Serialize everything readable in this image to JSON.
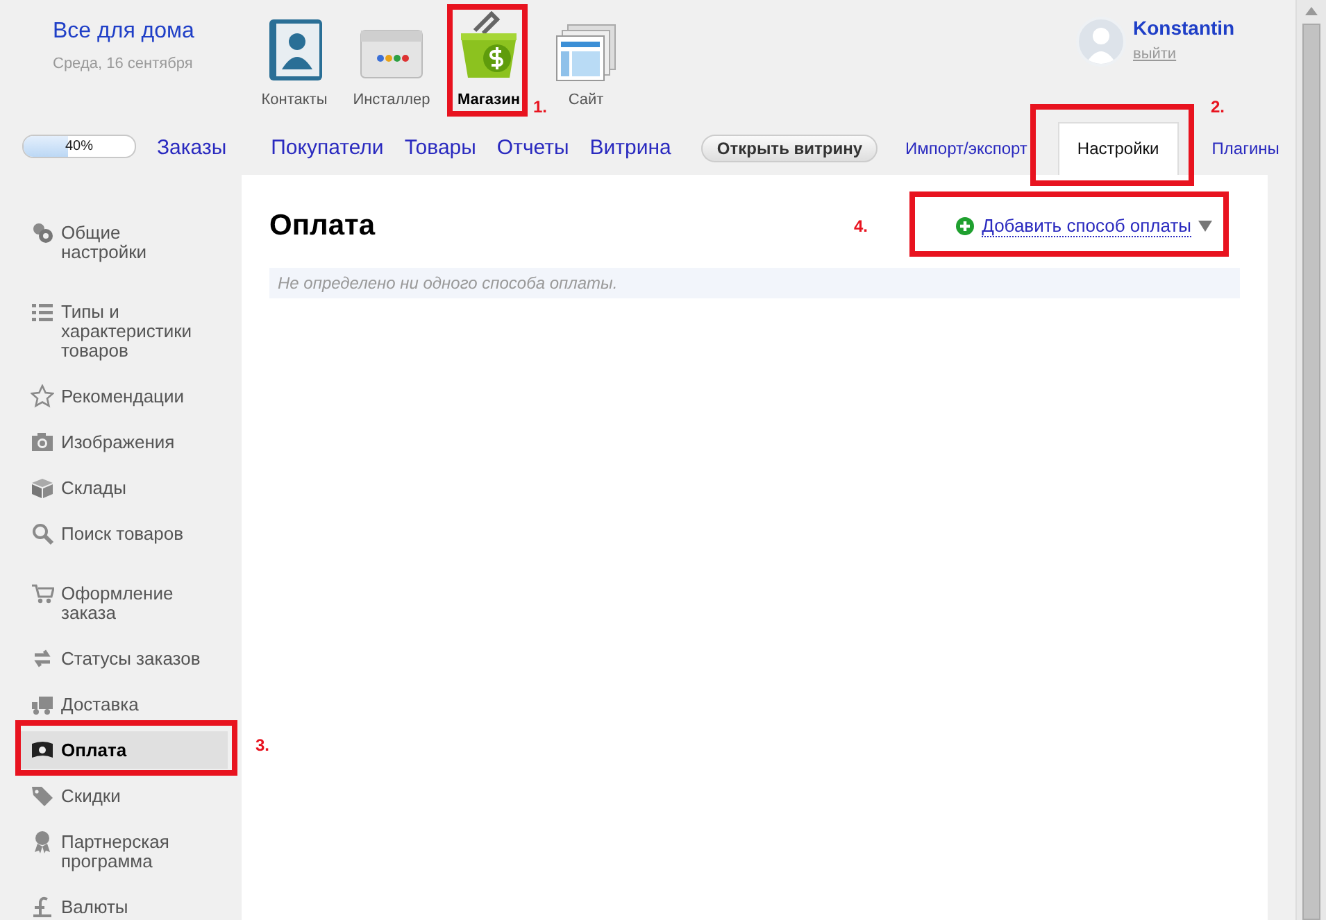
{
  "header": {
    "title": "Все для дома",
    "date": "Среда, 16 сентября"
  },
  "apps": [
    {
      "label": "Контакты",
      "kind": "contacts",
      "selected": false
    },
    {
      "label": "Инсталлер",
      "kind": "installer",
      "selected": false
    },
    {
      "label": "Магазин",
      "kind": "shop",
      "selected": true
    },
    {
      "label": "Сайт",
      "kind": "site",
      "selected": false
    }
  ],
  "user": {
    "name": "Konstantin",
    "logout": "выйти"
  },
  "progress": {
    "level": 0.4,
    "reading": "40%"
  },
  "nav": [
    {
      "label": "Заказы"
    },
    {
      "label": "Покупатели"
    },
    {
      "label": "Товары"
    },
    {
      "label": "Отчеты"
    },
    {
      "label": "Витрина"
    }
  ],
  "open_store_button": "Открыть витрину",
  "tabs": [
    {
      "label": "Импорт/экспорт",
      "selected": false
    },
    {
      "label": "Настройки",
      "selected": true
    },
    {
      "label": "Плагины",
      "selected": false
    }
  ],
  "sidebar": {
    "groups": [
      {
        "items": [
          {
            "label": "Общие настройки",
            "kind": "gears",
            "selected": false
          }
        ]
      },
      {
        "items": [
          {
            "label": "Типы и характеристики товаров",
            "kind": "list",
            "selected": false
          },
          {
            "label": "Рекомендации",
            "kind": "star",
            "selected": false
          },
          {
            "label": "Изображения",
            "kind": "camera",
            "selected": false
          },
          {
            "label": "Склады",
            "kind": "box",
            "selected": false
          },
          {
            "label": "Поиск товаров",
            "kind": "search",
            "selected": false
          }
        ]
      },
      {
        "items": [
          {
            "label": "Оформление заказа",
            "kind": "cart",
            "selected": false
          },
          {
            "label": "Статусы заказов",
            "kind": "arrows",
            "selected": false
          },
          {
            "label": "Доставка",
            "kind": "truck",
            "selected": false
          },
          {
            "label": "Оплата",
            "kind": "money",
            "selected": true
          },
          {
            "label": "Скидки",
            "kind": "tag",
            "selected": false
          },
          {
            "label": "Партнерская программа",
            "kind": "award",
            "selected": false
          },
          {
            "label": "Валюты",
            "kind": "pound",
            "selected": false
          }
        ]
      }
    ]
  },
  "page": {
    "title": "Оплата",
    "add_link": "Добавить способ оплаты",
    "empty_message": "Не определено ни одного способа оплаты."
  },
  "annotations": [
    {
      "label": "1."
    },
    {
      "label": "2."
    },
    {
      "label": "3."
    },
    {
      "label": "4."
    }
  ]
}
